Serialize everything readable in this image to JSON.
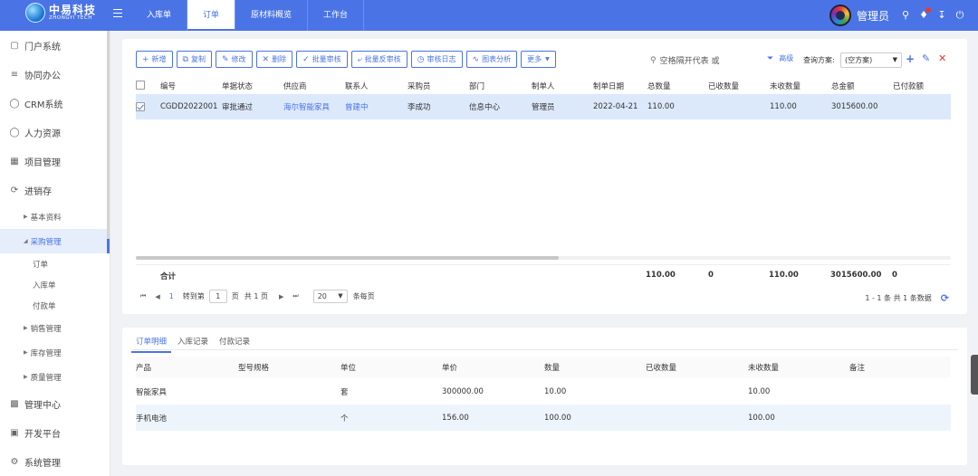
{
  "brand": {
    "name": "中易科技",
    "sub": "ZHONGYI TECH"
  },
  "topnav": [
    {
      "label": "入库单",
      "active": false
    },
    {
      "label": "订单",
      "active": true
    },
    {
      "label": "原材料概览",
      "active": false
    },
    {
      "label": "工作台",
      "active": false
    }
  ],
  "user": {
    "name": "管理员"
  },
  "sidebar": {
    "items": [
      {
        "label": "门户系统",
        "icon": "folder-icon"
      },
      {
        "label": "协同办公",
        "icon": "grid-icon"
      },
      {
        "label": "CRM系统",
        "icon": "user-icon"
      },
      {
        "label": "人力资源",
        "icon": "users-icon"
      },
      {
        "label": "项目管理",
        "icon": "calendar-icon"
      },
      {
        "label": "进销存",
        "icon": "sync-icon"
      }
    ],
    "sub_basic": "基本资料",
    "sub_purchase": "采购管理",
    "leaf": [
      "订单",
      "入库单",
      "付款单"
    ],
    "sub_more": [
      "销售管理",
      "库存管理",
      "质量管理"
    ],
    "bottom": [
      {
        "label": "管理中心",
        "icon": "chart-icon"
      },
      {
        "label": "开发平台",
        "icon": "dev-icon"
      },
      {
        "label": "系统管理",
        "icon": "settings-icon"
      }
    ]
  },
  "toolbar": {
    "add": "新增",
    "copy": "复制",
    "edit": "修改",
    "delete": "删除",
    "batch_audit": "批量审核",
    "batch_unaudit": "批量反审核",
    "audit_log": "审核日志",
    "chart": "图表分析",
    "more": "更多"
  },
  "search": {
    "placeholder": "空格隔开代表 或"
  },
  "filter": {
    "advanced": "高级",
    "scheme_label": "查询方案:",
    "scheme_value": "(空方案)"
  },
  "grid": {
    "headers": [
      "编号",
      "单据状态",
      "供应商",
      "联系人",
      "采购员",
      "部门",
      "制单人",
      "制单日期",
      "总数量",
      "已收数量",
      "未收数量",
      "总金额",
      "已付款额"
    ],
    "row": {
      "code": "CGDD2022001",
      "status": "审批通过",
      "supplier": "海尔智能家具",
      "contact": "曾建中",
      "buyer": "李成功",
      "dept": "信息中心",
      "maker": "管理员",
      "date": "2022-04-21",
      "total_qty": "110.00",
      "received": "",
      "unreceived": "110.00",
      "amount": "3015600.00",
      "paid": ""
    },
    "sum": {
      "label": "合计",
      "total_qty": "110.00",
      "received": "0",
      "unreceived": "110.00",
      "amount": "3015600.00",
      "paid": "0"
    }
  },
  "pager": {
    "goto": "转到第",
    "page_input": "1",
    "page_unit": "页",
    "total_pages": "共 1 页",
    "page_size": "20",
    "per_page": "条每页",
    "current": "1",
    "summary": "1 - 1 条   共 1 条数据"
  },
  "tabs": [
    "订单明细",
    "入库记录",
    "付款记录"
  ],
  "detail": {
    "headers": [
      "产品",
      "型号规格",
      "单位",
      "单价",
      "数量",
      "已收数量",
      "未收数量",
      "备注"
    ],
    "rows": [
      {
        "product": "智能家具",
        "spec": "",
        "unit": "套",
        "price": "300000.00",
        "qty": "10.00",
        "received": "",
        "unreceived": "10.00",
        "note": ""
      },
      {
        "product": "手机电池",
        "spec": "",
        "unit": "个",
        "price": "156.00",
        "qty": "100.00",
        "received": "",
        "unreceived": "100.00",
        "note": ""
      }
    ]
  }
}
